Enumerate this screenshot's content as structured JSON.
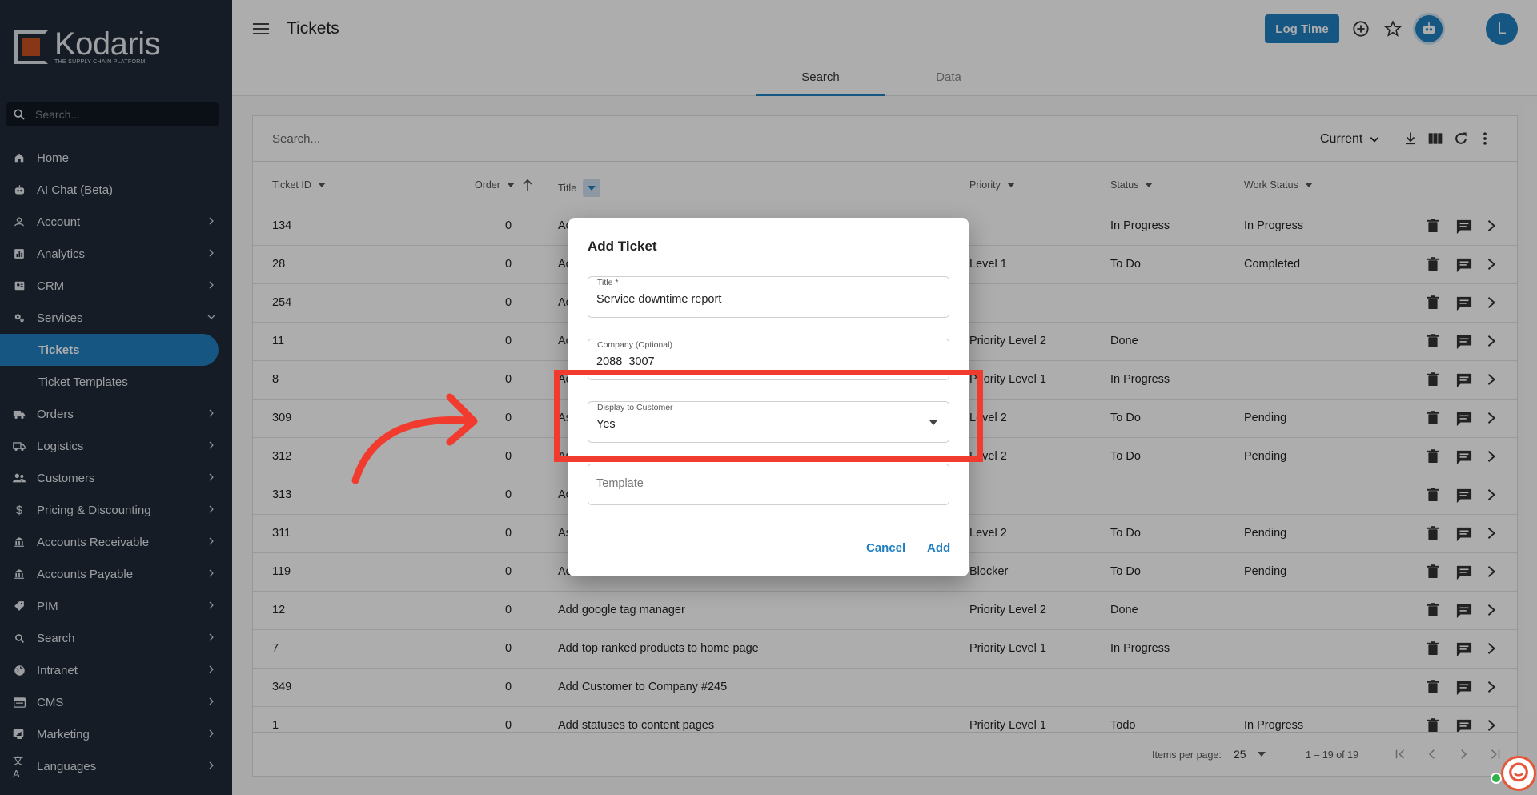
{
  "brand": {
    "name": "Kodaris",
    "tagline": "THE SUPPLY CHAIN PLATFORM"
  },
  "sidebar": {
    "search_placeholder": "Search...",
    "items": [
      {
        "label": "Home",
        "icon": "home-icon"
      },
      {
        "label": "AI Chat (Beta)",
        "icon": "robot-icon"
      },
      {
        "label": "Account",
        "icon": "person-icon"
      },
      {
        "label": "Analytics",
        "icon": "chart-icon"
      },
      {
        "label": "CRM",
        "icon": "contact-icon"
      },
      {
        "label": "Services",
        "icon": "gears-icon"
      },
      {
        "label": "Tickets",
        "icon": ""
      },
      {
        "label": "Ticket Templates",
        "icon": ""
      },
      {
        "label": "Orders",
        "icon": "truck-icon"
      },
      {
        "label": "Logistics",
        "icon": "shipping-icon"
      },
      {
        "label": "Customers",
        "icon": "group-icon"
      },
      {
        "label": "Pricing & Discounting",
        "icon": "dollar-icon"
      },
      {
        "label": "Accounts Receivable",
        "icon": "bank-icon"
      },
      {
        "label": "Accounts Payable",
        "icon": "bank-icon"
      },
      {
        "label": "PIM",
        "icon": "tag-icon"
      },
      {
        "label": "Search",
        "icon": "search-icon"
      },
      {
        "label": "Intranet",
        "icon": "globe-icon"
      },
      {
        "label": "CMS",
        "icon": "web-icon"
      },
      {
        "label": "Marketing",
        "icon": "megaphone-icon"
      },
      {
        "label": "Languages",
        "icon": "translate-icon"
      }
    ]
  },
  "header": {
    "title": "Tickets",
    "log_time": "Log Time",
    "avatar_initial": "L",
    "tabs": [
      {
        "label": "Search"
      },
      {
        "label": "Data"
      }
    ]
  },
  "table": {
    "search_placeholder": "Search...",
    "view_select": "Current",
    "columns": {
      "ticket_id": "Ticket ID",
      "order": "Order",
      "title": "Title",
      "priority": "Priority",
      "status": "Status",
      "work_status": "Work Status"
    },
    "rows": [
      {
        "id": "134",
        "order": "0",
        "title": "Ac",
        "priority": "",
        "status": "In Progress",
        "work_status": "In Progress"
      },
      {
        "id": "28",
        "order": "0",
        "title": "Ac",
        "priority": "Level 1",
        "status": "To Do",
        "work_status": "Completed"
      },
      {
        "id": "254",
        "order": "0",
        "title": "Ac",
        "priority": "",
        "status": "",
        "work_status": ""
      },
      {
        "id": "11",
        "order": "0",
        "title": "Ac",
        "priority": "Priority Level 2",
        "status": "Done",
        "work_status": ""
      },
      {
        "id": "8",
        "order": "0",
        "title": "Ac",
        "priority": "Priority Level 1",
        "status": "In Progress",
        "work_status": ""
      },
      {
        "id": "309",
        "order": "0",
        "title": "As",
        "priority": "Level 2",
        "status": "To Do",
        "work_status": "Pending"
      },
      {
        "id": "312",
        "order": "0",
        "title": "As",
        "priority": "Level 2",
        "status": "To Do",
        "work_status": "Pending"
      },
      {
        "id": "313",
        "order": "0",
        "title": "Ac",
        "priority": "",
        "status": "",
        "work_status": ""
      },
      {
        "id": "311",
        "order": "0",
        "title": "As",
        "priority": "Level 2",
        "status": "To Do",
        "work_status": "Pending"
      },
      {
        "id": "119",
        "order": "0",
        "title": "Ac",
        "priority": "Blocker",
        "status": "To Do",
        "work_status": "Pending"
      },
      {
        "id": "12",
        "order": "0",
        "title": "Add google tag manager",
        "priority": "Priority Level 2",
        "status": "Done",
        "work_status": ""
      },
      {
        "id": "7",
        "order": "0",
        "title": "Add top ranked products to home page",
        "priority": "Priority Level 1",
        "status": "In Progress",
        "work_status": ""
      },
      {
        "id": "349",
        "order": "0",
        "title": "Add Customer to Company #245",
        "priority": "",
        "status": "",
        "work_status": ""
      },
      {
        "id": "1",
        "order": "0",
        "title": "Add statuses to content pages",
        "priority": "Priority Level 1",
        "status": "Todo",
        "work_status": "In Progress"
      }
    ],
    "footer": {
      "items_per_page_label": "Items per page:",
      "items_per_page": "25",
      "range": "1 – 19 of 19"
    }
  },
  "dialog": {
    "title": "Add Ticket",
    "title_field": {
      "label": "Title *",
      "value": "Service downtime report"
    },
    "company_field": {
      "label": "Company (Optional)",
      "value": "2088_3007"
    },
    "display_field": {
      "label": "Display to Customer",
      "value": "Yes"
    },
    "template_field": {
      "placeholder": "Template"
    },
    "cancel": "Cancel",
    "add": "Add"
  },
  "colors": {
    "accent": "#1f7fc0",
    "sidebar": "#1f2a37",
    "highlight": "#f23b2f",
    "logo": "#c8521f"
  }
}
